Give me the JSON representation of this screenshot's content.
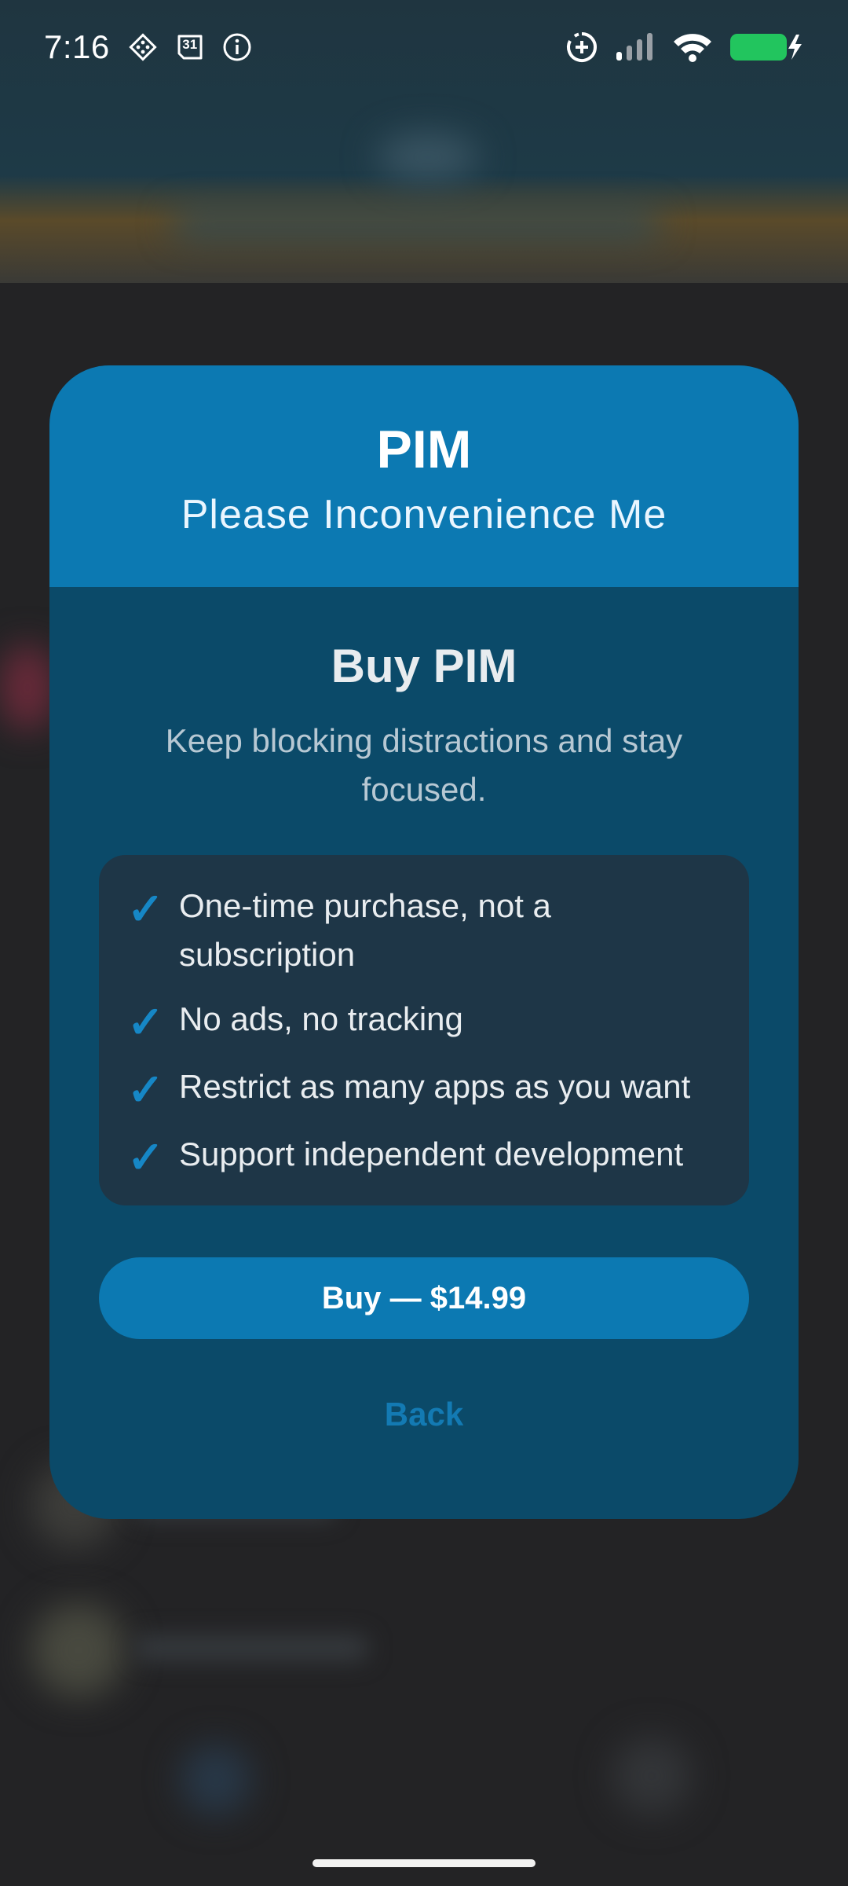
{
  "status_bar": {
    "time": "7:16",
    "left_icons": [
      "grid-diamond-icon",
      "calendar-icon",
      "info-icon"
    ],
    "calendar_day": "31",
    "right_icons": [
      "data-saver-icon",
      "signal-icon",
      "wifi-icon",
      "battery-charging-icon"
    ],
    "battery_color": "#22c55e"
  },
  "dialog": {
    "app_name": "PIM",
    "tagline": "Please Inconvenience Me",
    "title": "Buy PIM",
    "subtitle": "Keep blocking distractions and stay focused.",
    "features": [
      "One-time purchase, not a subscription",
      "No ads, no tracking",
      "Restrict as many apps as you want",
      "Support independent development"
    ],
    "check_mark": "✓",
    "buy_label": "Buy — $14.99",
    "back_label": "Back"
  },
  "colors": {
    "header": "#0c79b2",
    "dialog_body": "#0b4a69",
    "feature_box": "#1e3647",
    "accent": "#1687c6"
  }
}
